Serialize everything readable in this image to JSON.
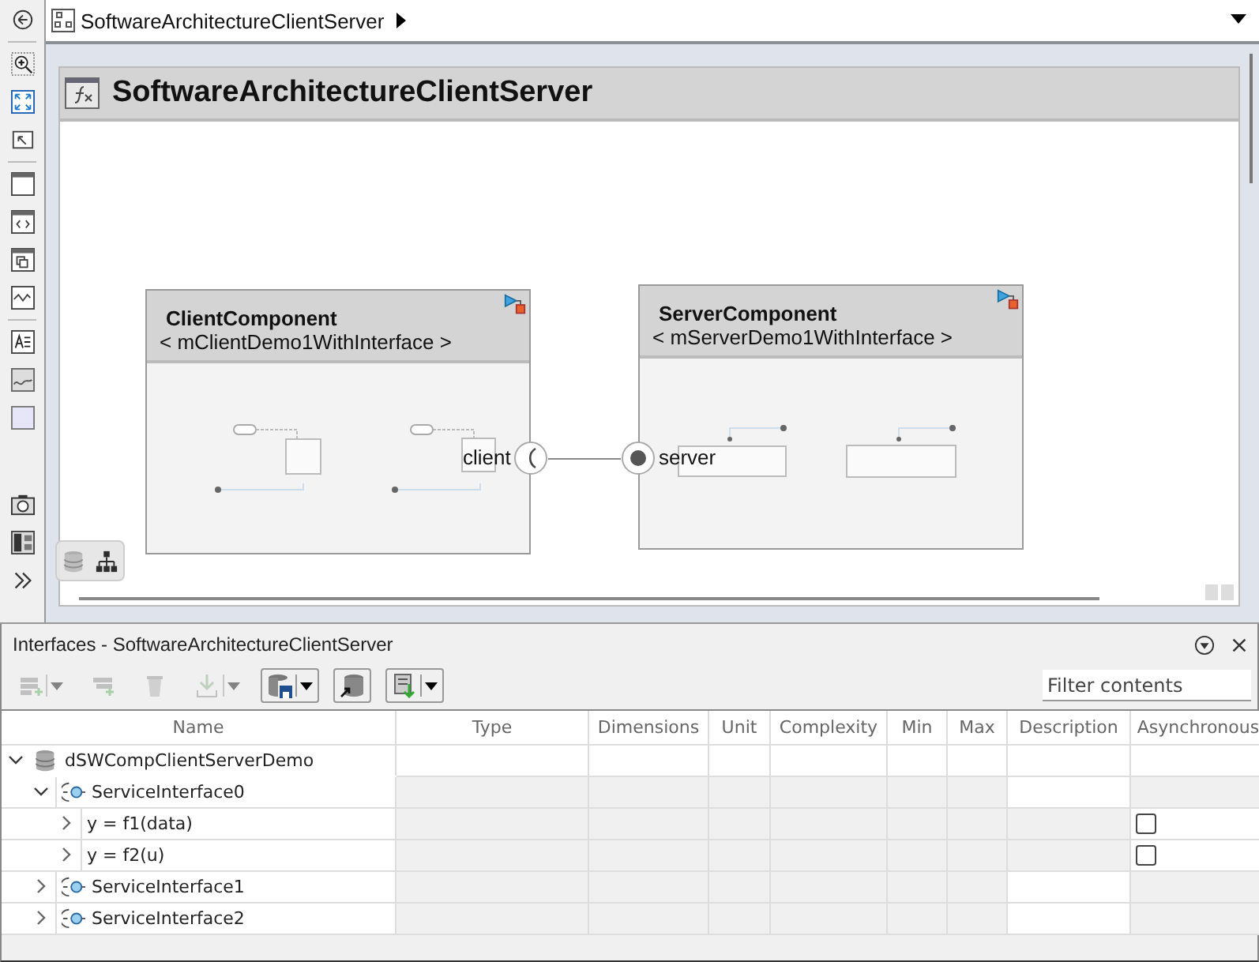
{
  "breadcrumb": {
    "title": "SoftwareArchitectureClientServer"
  },
  "diagram": {
    "title": "SoftwareArchitectureClientServer",
    "components": [
      {
        "name": "ClientComponent",
        "reference": "< mClientDemo1WithInterface >",
        "port": {
          "kind": "client",
          "label": "client"
        }
      },
      {
        "name": "ServerComponent",
        "reference": "< mServerDemo1WithInterface >",
        "port": {
          "kind": "server",
          "label": "server"
        }
      }
    ]
  },
  "interfaces_panel": {
    "title": "Interfaces - SoftwareArchitectureClientServer",
    "toolbar": [
      {
        "kind": "add-row",
        "disabled": true,
        "dropdown": true
      },
      {
        "kind": "add-child",
        "disabled": true,
        "dropdown": false
      },
      {
        "kind": "delete",
        "disabled": true,
        "dropdown": false
      },
      {
        "kind": "import",
        "disabled": true,
        "dropdown": true
      },
      {
        "kind": "save",
        "disabled": false,
        "dropdown": true
      },
      {
        "kind": "link",
        "disabled": false,
        "dropdown": false
      },
      {
        "kind": "export",
        "disabled": false,
        "dropdown": true
      }
    ],
    "filter": {
      "placeholder": "Filter contents"
    },
    "table": {
      "columns": [
        "Name",
        "Type",
        "Dimensions",
        "Unit",
        "Complexity",
        "Min",
        "Max",
        "Description",
        "Asynchronous"
      ],
      "rows": [
        {
          "name": "dSWCompClientServerDemo",
          "kind": "dictionary",
          "expanded": true,
          "children": [
            {
              "name": "ServiceInterface0",
              "kind": "interface",
              "expanded": true,
              "children": [
                {
                  "name": "y = f1(data)",
                  "kind": "function",
                  "expanded": false,
                  "asynchronous": false
                },
                {
                  "name": "y = f2(u)",
                  "kind": "function",
                  "expanded": false,
                  "asynchronous": false
                }
              ]
            },
            {
              "name": "ServiceInterface1",
              "kind": "interface",
              "expanded": false
            },
            {
              "name": "ServiceInterface2",
              "kind": "interface",
              "expanded": false
            }
          ]
        }
      ]
    }
  }
}
